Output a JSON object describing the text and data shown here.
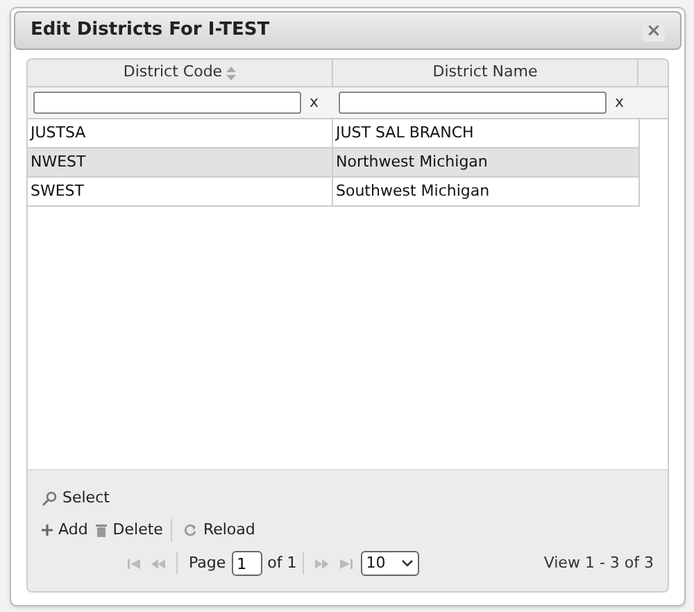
{
  "dialog": {
    "title": "Edit Districts For I-TEST",
    "close": "×"
  },
  "table": {
    "columns": [
      {
        "label": "District Code",
        "sortable": true
      },
      {
        "label": "District Name",
        "sortable": false
      }
    ],
    "filter_clear": [
      "x",
      "x"
    ],
    "rows": [
      {
        "cells": [
          "JUSTSA",
          "JUST SAL BRANCH"
        ],
        "selected": false
      },
      {
        "cells": [
          "NWEST",
          "Northwest Michigan"
        ],
        "selected": true
      },
      {
        "cells": [
          "SWEST",
          "Southwest Michigan"
        ],
        "selected": false
      }
    ]
  },
  "toolbar": {
    "select": "Select",
    "add": "Add",
    "delete": "Delete",
    "reload": "Reload"
  },
  "pager": {
    "page_label": "Page",
    "page": "1",
    "of": "of 1",
    "page_size": "10",
    "view": "View 1 - 3 of 3"
  }
}
